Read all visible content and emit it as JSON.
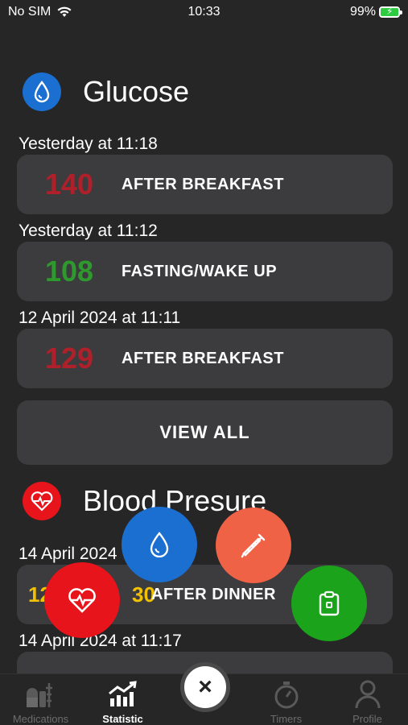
{
  "status": {
    "carrier": "No SIM",
    "time": "10:33",
    "battery": "99%"
  },
  "glucose": {
    "title": "Glucose",
    "icon": "water-drop-icon",
    "entries": [
      {
        "date": "Yesterday at 11:18",
        "value": "140",
        "label": "AFTER BREAKFAST",
        "color": "#b0202a"
      },
      {
        "date": "Yesterday at 11:12",
        "value": "108",
        "label": "FASTING/WAKE UP",
        "color": "#2e9a2e"
      },
      {
        "date": "12 April 2024 at 11:11",
        "value": "129",
        "label": "AFTER BREAKFAST",
        "color": "#b0202a"
      }
    ],
    "view_all": "VIEW ALL"
  },
  "blood_pressure": {
    "title": "Blood Presure",
    "icon": "heart-pulse-icon",
    "entries": [
      {
        "date": "14 April 2024",
        "value_start": "12",
        "value_end": "30",
        "label": "AFTER DINNER",
        "color": "#f2c200"
      },
      {
        "date": "14 April 2024 at 11:17"
      }
    ]
  },
  "tabs": [
    {
      "label": "Medications",
      "icon": "pills-syringe-icon",
      "active": false
    },
    {
      "label": "Statistic",
      "icon": "chart-up-icon",
      "active": true
    },
    {
      "label": "Timers",
      "icon": "stopwatch-icon",
      "active": false
    },
    {
      "label": "Profile",
      "icon": "person-icon",
      "active": false
    }
  ],
  "center_button": "×",
  "colors": {
    "background": "#262626",
    "card": "#3c3c3e",
    "glucose_blue": "#1a6fd1",
    "bp_red": "#e8141b",
    "fab_orange": "#f06245",
    "fab_green": "#1ba31b"
  }
}
